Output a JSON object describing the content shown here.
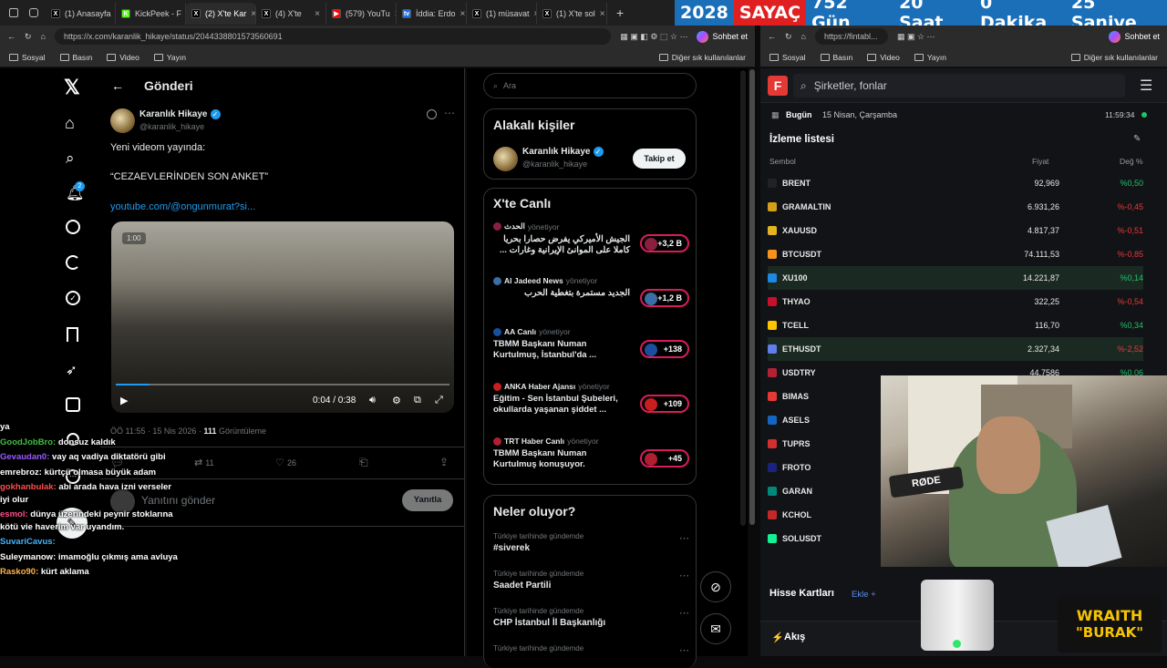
{
  "tabs": [
    {
      "label": "(1) Anasayfa",
      "fav": "X",
      "color": "#000"
    },
    {
      "label": "KickPeek - F",
      "fav": "K",
      "color": "#53fc18"
    },
    {
      "label": "(2) X'te Kar",
      "fav": "X",
      "color": "#000",
      "active": true
    },
    {
      "label": "(4) X'te",
      "fav": "X",
      "color": "#000"
    },
    {
      "label": "(579) YouTu",
      "fav": "▶",
      "color": "#ff0000"
    },
    {
      "label": "İddia: Erdo",
      "fav": "tv",
      "color": "#1a73e8"
    },
    {
      "label": "(1) müsavat",
      "fav": "X",
      "color": "#000"
    },
    {
      "label": "(1) X'te sol",
      "fav": "X",
      "color": "#000"
    }
  ],
  "countdown": {
    "year": "2028",
    "label": "SAYAÇ",
    "days": "752 Gün",
    "hours": "20 Saat",
    "minutes": "0 Dakika",
    "seconds": "25 Saniye"
  },
  "browser_left": {
    "url": "https://x.com/karanlik_hikaye/status/2044338801573560691",
    "copilot": "Sohbet et",
    "bookmarks": [
      "Sosyal",
      "Basın",
      "Video",
      "Yayın"
    ],
    "other": "Diğer sık kullanılanlar"
  },
  "browser_right": {
    "url": "https://fintabl...",
    "copilot": "Sohbet et",
    "bookmarks": [
      "Sosyal",
      "Basın",
      "Video",
      "Yayın"
    ],
    "other": "Diğer sık kullanılanlar"
  },
  "nav": {
    "badge": "2"
  },
  "post": {
    "header": "Gönderi",
    "author": "Karanlık Hikaye",
    "handle": "@karanlik_hikaye",
    "line1": "Yeni videom yayında:",
    "line2": "“CEZAEVLERİNDEN SON ANKET”",
    "link": "youtube.com/@ongunmurat?si...",
    "video_badge": "1:00",
    "video_time": "0:04 / 0:38",
    "meta_time": "ÖÖ 11:55 · 15 Nis 2026 · ",
    "views": "111",
    "views_label": "Görüntüleme",
    "retweets": "11",
    "likes": "26",
    "reply_placeholder": "Yanıtını gönder",
    "reply_button": "Yanıtla"
  },
  "search_placeholder": "Ara",
  "related": {
    "title": "Alakalı kişiler",
    "name": "Karanlık Hikaye",
    "handle": "@karanlik_hikaye",
    "follow": "Takip et"
  },
  "live": {
    "title": "X'te Canlı",
    "items": [
      {
        "source": "الحدث",
        "role": "yönetiyor",
        "text": "الجيش الأميركي يفرض حصارا بحريا كاملا على الموانئ الإيرانية وغارات ...",
        "count": "+3,2 B"
      },
      {
        "source": "Al Jadeed News",
        "role": "yönetiyor",
        "text": "الجديد مستمرة بتغطية الحرب",
        "count": "+1,2 B"
      },
      {
        "source": "AA Canlı",
        "role": "yönetiyor",
        "text": "TBMM Başkanı Numan Kurtulmuş, İstanbul'da ...",
        "count": "+138"
      },
      {
        "source": "ANKA Haber Ajansı",
        "role": "yönetiyor",
        "text": "Eğitim - Sen İstanbul Şubeleri, okullarda yaşanan şiddet ...",
        "count": "+109"
      },
      {
        "source": "TRT Haber Canlı",
        "role": "yönetiyor",
        "text": "TBMM Başkanı Numan Kurtulmuş konuşuyor.",
        "count": "+45"
      }
    ]
  },
  "trends": {
    "title": "Neler oluyor?",
    "items": [
      {
        "cat": "Türkiye tarihinde gündemde",
        "title": "#siverek"
      },
      {
        "cat": "Türkiye tarihinde gündemde",
        "title": "Saadet Partili"
      },
      {
        "cat": "Türkiye tarihinde gündemde",
        "title": "CHP İstanbul İl Başkanlığı"
      },
      {
        "cat": "Türkiye tarihinde gündemde",
        "title": ""
      }
    ]
  },
  "fin": {
    "search": "Şirketler, fonlar",
    "today": "Bugün",
    "date": "15 Nisan, Çarşamba",
    "time": "11:59:34",
    "watchlist": "İzleme listesi",
    "cols": [
      "Sembol",
      "Fiyat",
      "Değ %"
    ],
    "rows": [
      {
        "sym": "BRENT",
        "price": "92,969",
        "chg": "%0,50",
        "dir": "pos",
        "icolor": "#222"
      },
      {
        "sym": "GRAMALTIN",
        "price": "6.931,26",
        "chg": "%-0,45",
        "dir": "neg",
        "icolor": "#d4a017"
      },
      {
        "sym": "XAUUSD",
        "price": "4.817,37",
        "chg": "%-0,51",
        "dir": "neg",
        "icolor": "#e5b320"
      },
      {
        "sym": "BTCUSDT",
        "price": "74.111,53",
        "chg": "%-0,85",
        "dir": "neg",
        "icolor": "#f7931a"
      },
      {
        "sym": "XU100",
        "price": "14.221,87",
        "chg": "%0,14",
        "dir": "pos",
        "icolor": "#1e88e5"
      },
      {
        "sym": "THYAO",
        "price": "322,25",
        "chg": "%-0,54",
        "dir": "neg",
        "icolor": "#c8102e"
      },
      {
        "sym": "TCELL",
        "price": "116,70",
        "chg": "%0,34",
        "dir": "pos",
        "icolor": "#ffc400"
      },
      {
        "sym": "ETHUSDT",
        "price": "2.327,34",
        "chg": "%-2,52",
        "dir": "neg",
        "icolor": "#627eea"
      },
      {
        "sym": "USDTRY",
        "price": "44,7586",
        "chg": "%0,06",
        "dir": "pos",
        "icolor": "#b22234"
      },
      {
        "sym": "BIMAS",
        "price": "",
        "chg": "",
        "dir": "pos",
        "icolor": "#e53935"
      },
      {
        "sym": "ASELS",
        "price": "",
        "chg": "",
        "dir": "pos",
        "icolor": "#1565c0"
      },
      {
        "sym": "TUPRS",
        "price": "",
        "chg": "",
        "dir": "pos",
        "icolor": "#d32f2f"
      },
      {
        "sym": "FROTO",
        "price": "",
        "chg": "",
        "dir": "pos",
        "icolor": "#1a237e"
      },
      {
        "sym": "GARAN",
        "price": "",
        "chg": "",
        "dir": "pos",
        "icolor": "#00897b"
      },
      {
        "sym": "KCHOL",
        "price": "",
        "chg": "",
        "dir": "pos",
        "icolor": "#c62828"
      },
      {
        "sym": "SOLUSDT",
        "price": "",
        "chg": "",
        "dir": "pos",
        "icolor": "#14f195"
      }
    ],
    "cards": "Hisse Kartları",
    "add": "Ekle",
    "flow": "Akış"
  },
  "chat": [
    {
      "user": "",
      "text": "ya",
      "color": "#ffffff"
    },
    {
      "user": "GoodJobBro:",
      "text": "donsuz kaldık",
      "color": "#3fbf3f"
    },
    {
      "user": "Gevaudan0:",
      "text": "vay aq vadiya diktatörü gibi",
      "color": "#9b59ff"
    },
    {
      "user": "emrebroz:",
      "text": "kürtçü olmasa büyük adam",
      "color": "#ffffff"
    },
    {
      "user": "gokhanbulak:",
      "text": "abi arada hava izni verseler iyi olur",
      "color": "#ff4d4d"
    },
    {
      "user": "esmol:",
      "text": "dünya üzerindeki peynir stoklarına kötü vie haverim var uyandım.",
      "color": "#ff4d8d"
    },
    {
      "user": "SuvariCavus:",
      "text": "",
      "color": "#3fb6ff"
    },
    {
      "user": "Suleymanow:",
      "text": "imamoğlu çıkmış ama avluya",
      "color": "#ffffff"
    },
    {
      "user": "Rasko90:",
      "text": "kürt aklama",
      "color": "#ffb347"
    }
  ],
  "overlay": {
    "mic": "RØDE",
    "brand1": "WRAITH",
    "brand2": "\"BURAK\""
  }
}
